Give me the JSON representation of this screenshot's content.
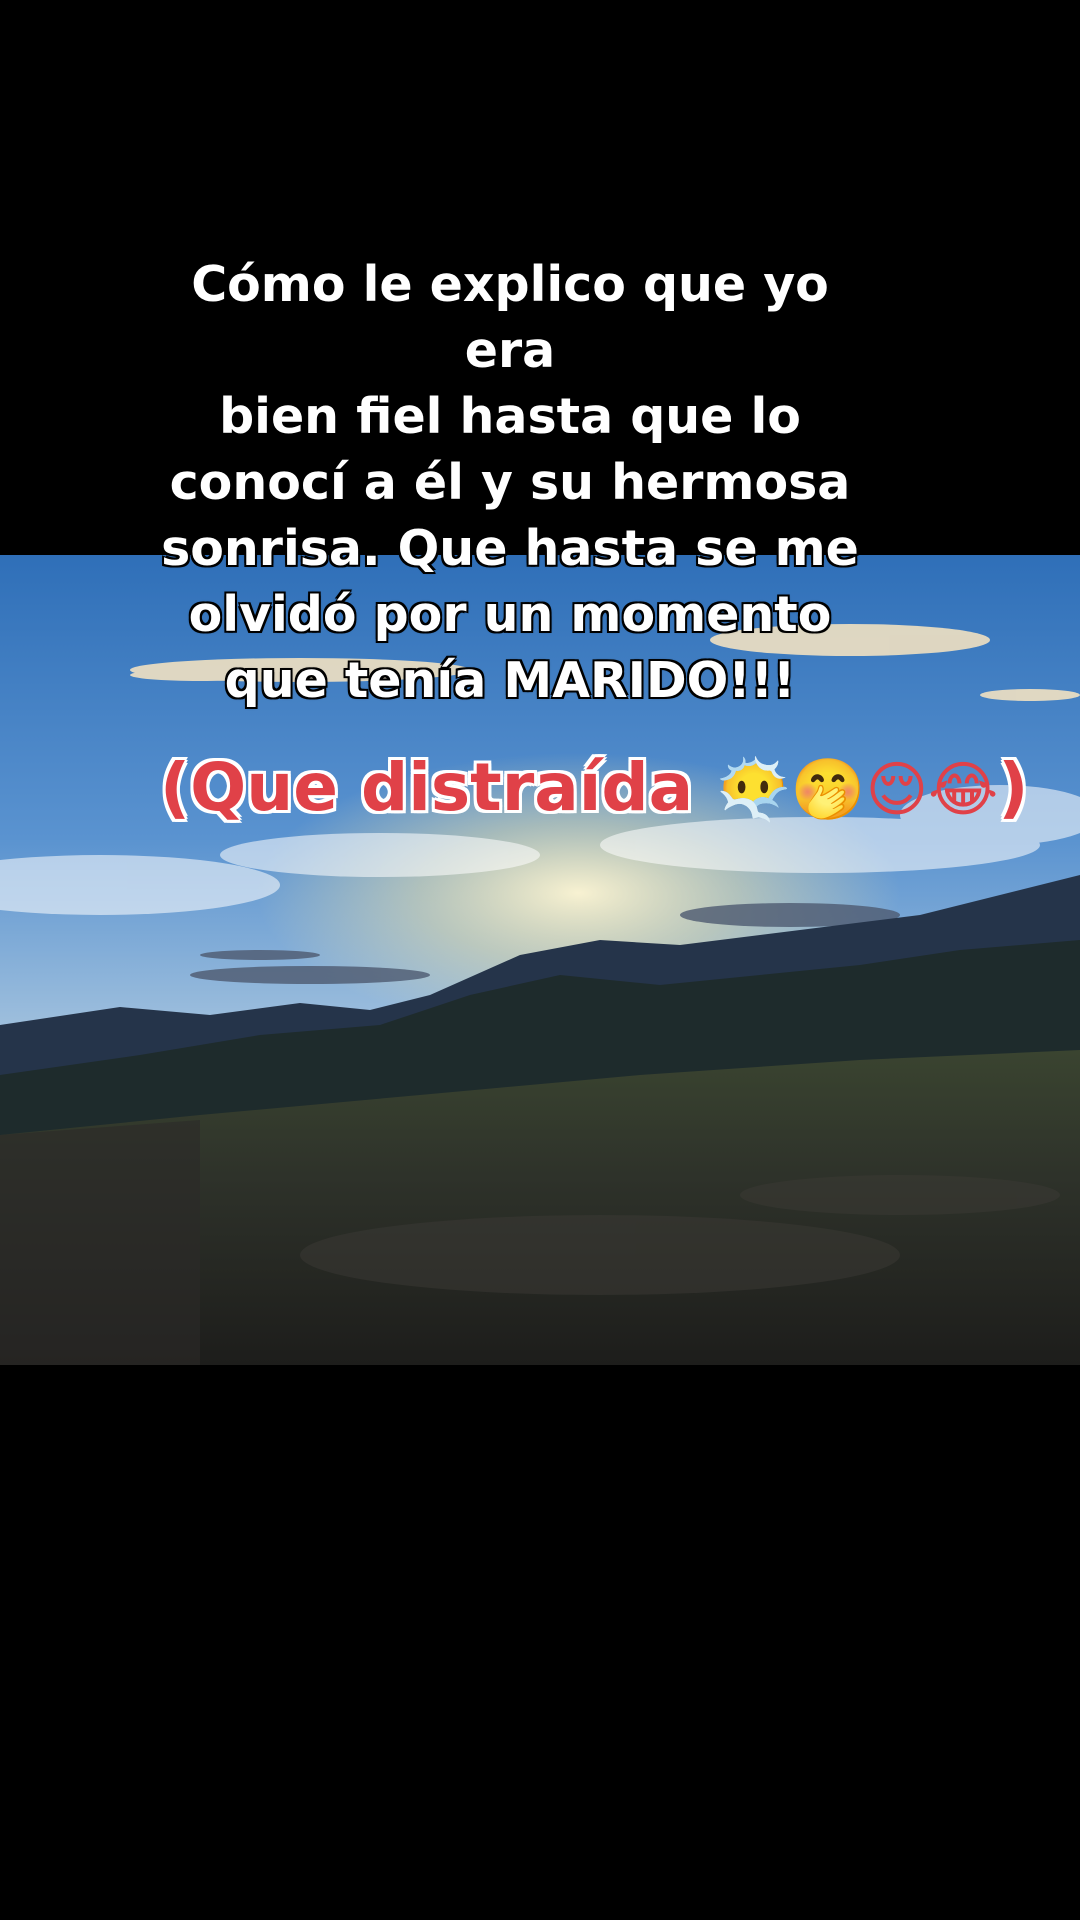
{
  "video": {
    "caption_lines": [
      "Cómo le explico que yo era",
      "bien fiel hasta que lo",
      "conocí a él y su hermosa",
      "sonrisa. Que hasta se me",
      "olvidó por un momento",
      "que tenía MARIDO!!!"
    ],
    "accent_open": "(Que distraída ",
    "emojis": [
      "😶‍🌫️",
      "🤭",
      "😌",
      "😂"
    ],
    "accent_close": ")",
    "colors": {
      "background": "#000000",
      "caption_text": "#ffffff",
      "accent_text": "#e04148",
      "sky_top": "#3f7fc6",
      "sky_horizon": "#f3e9b8",
      "mountains": "#1c2a3f",
      "ground": "#2a2a26"
    }
  }
}
